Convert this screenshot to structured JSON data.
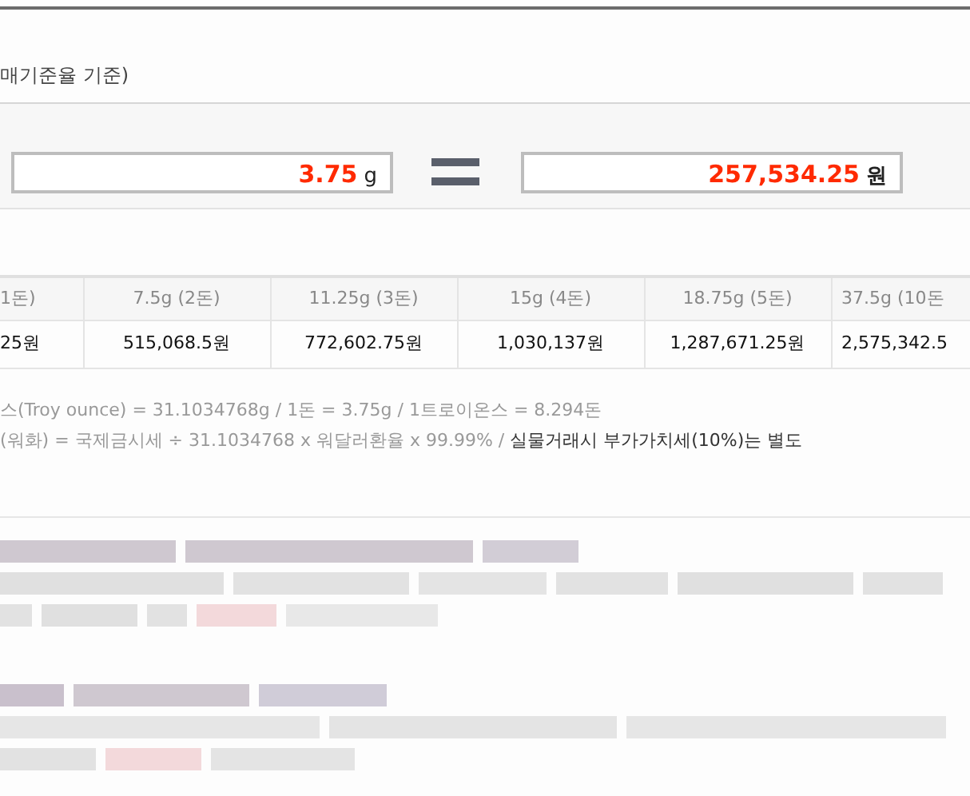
{
  "heading": "매기준율 기준)",
  "converter": {
    "weight": {
      "value": "3.75",
      "unit": "g"
    },
    "price": {
      "value": "257,534.25",
      "unit": "원"
    }
  },
  "table": {
    "columns": [
      "1돈)",
      "7.5g (2돈)",
      "11.25g (3돈)",
      "15g (4돈)",
      "18.75g (5돈)",
      "37.5g (10돈"
    ],
    "rows": [
      [
        "25원",
        "515,068.5원",
        "772,602.75원",
        "1,030,137원",
        "1,287,671.25원",
        "2,575,342.5"
      ]
    ]
  },
  "notes": [
    "스(Troy ounce) = 31.1034768g / 1돈 = 3.75g / 1트로이온스 = 8.294돈",
    "(워화) = 국제금시세 ÷ 31.1034768 x 워달러환율 x 99.99% / **실물거래시 부가가치세(10%)는 별도**"
  ]
}
